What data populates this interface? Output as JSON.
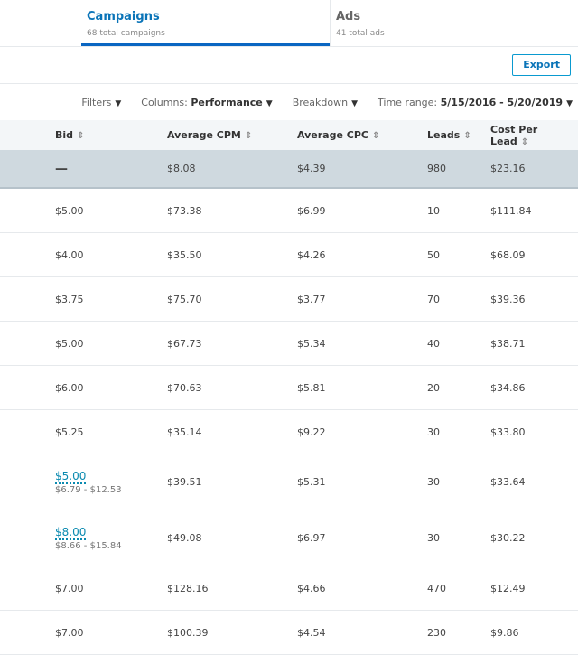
{
  "tabs": [
    {
      "title": "Campaigns",
      "sub": "68 total campaigns"
    },
    {
      "title": "Ads",
      "sub": "41 total ads"
    }
  ],
  "toolbar": {
    "export": "Export"
  },
  "filters": {
    "filters": "Filters",
    "columns_label": "Columns:",
    "columns_value": "Performance",
    "breakdown": "Breakdown",
    "time_label": "Time range:",
    "time_value": "5/15/2016 - 5/20/2019"
  },
  "columns": [
    "Bid",
    "Average CPM",
    "Average CPC",
    "Leads",
    "Cost Per Lead"
  ],
  "totals": {
    "bid": "—",
    "cpm": "$8.08",
    "cpc": "$4.39",
    "leads": "980",
    "cpl": "$23.16"
  },
  "rows": [
    {
      "bid": "$5.00",
      "cpm": "$73.38",
      "cpc": "$6.99",
      "leads": "10",
      "cpl": "$111.84"
    },
    {
      "bid": "$4.00",
      "cpm": "$35.50",
      "cpc": "$4.26",
      "leads": "50",
      "cpl": "$68.09"
    },
    {
      "bid": "$3.75",
      "cpm": "$75.70",
      "cpc": "$3.77",
      "leads": "70",
      "cpl": "$39.36"
    },
    {
      "bid": "$5.00",
      "cpm": "$67.73",
      "cpc": "$5.34",
      "leads": "40",
      "cpl": "$38.71"
    },
    {
      "bid": "$6.00",
      "cpm": "$70.63",
      "cpc": "$5.81",
      "leads": "20",
      "cpl": "$34.86"
    },
    {
      "bid": "$5.25",
      "cpm": "$35.14",
      "cpc": "$9.22",
      "leads": "30",
      "cpl": "$33.80"
    },
    {
      "bid": "$5.00",
      "range": "$6.79 - $12.53",
      "cpm": "$39.51",
      "cpc": "$5.31",
      "leads": "30",
      "cpl": "$33.64"
    },
    {
      "bid": "$8.00",
      "range": "$8.66 - $15.84",
      "cpm": "$49.08",
      "cpc": "$6.97",
      "leads": "30",
      "cpl": "$30.22"
    },
    {
      "bid": "$7.00",
      "cpm": "$128.16",
      "cpc": "$4.66",
      "leads": "470",
      "cpl": "$12.49"
    },
    {
      "bid": "$7.00",
      "cpm": "$100.39",
      "cpc": "$4.54",
      "leads": "230",
      "cpl": "$9.86"
    }
  ]
}
